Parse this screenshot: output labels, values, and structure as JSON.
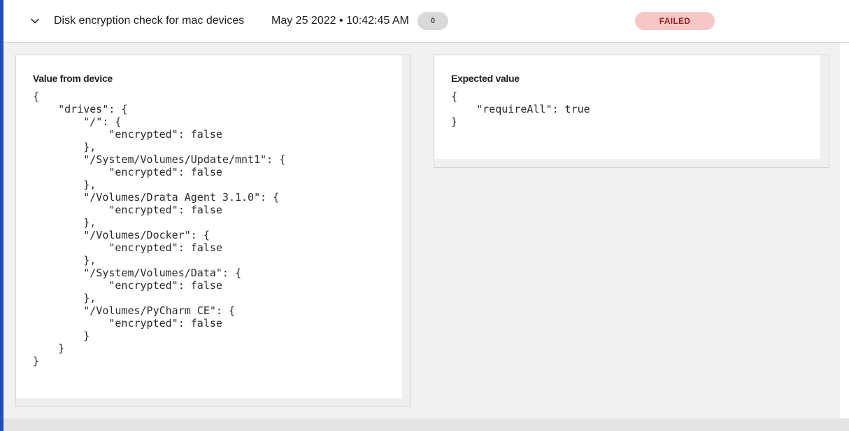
{
  "check": {
    "title": "Disk encryption check for mac devices",
    "timestamp": "May 25 2022 • 10:42:45 AM",
    "count": "0",
    "status": "FAILED",
    "status_color": "#f7c7c7",
    "status_text_color": "#9a1b1b"
  },
  "icons": {
    "expand": "chevron-down-icon"
  },
  "device_panel": {
    "label": "Value from device",
    "value": "{\n    \"drives\": {\n        \"/\": {\n            \"encrypted\": false\n        },\n        \"/System/Volumes/Update/mnt1\": {\n            \"encrypted\": false\n        },\n        \"/Volumes/Drata Agent 3.1.0\": {\n            \"encrypted\": false\n        },\n        \"/Volumes/Docker\": {\n            \"encrypted\": false\n        },\n        \"/System/Volumes/Data\": {\n            \"encrypted\": false\n        },\n        \"/Volumes/PyCharm CE\": {\n            \"encrypted\": false\n        }\n    }\n}"
  },
  "expected_panel": {
    "label": "Expected value",
    "value": "{\n    \"requireAll\": true\n}"
  },
  "colors": {
    "accent": "#1f4fbf"
  }
}
